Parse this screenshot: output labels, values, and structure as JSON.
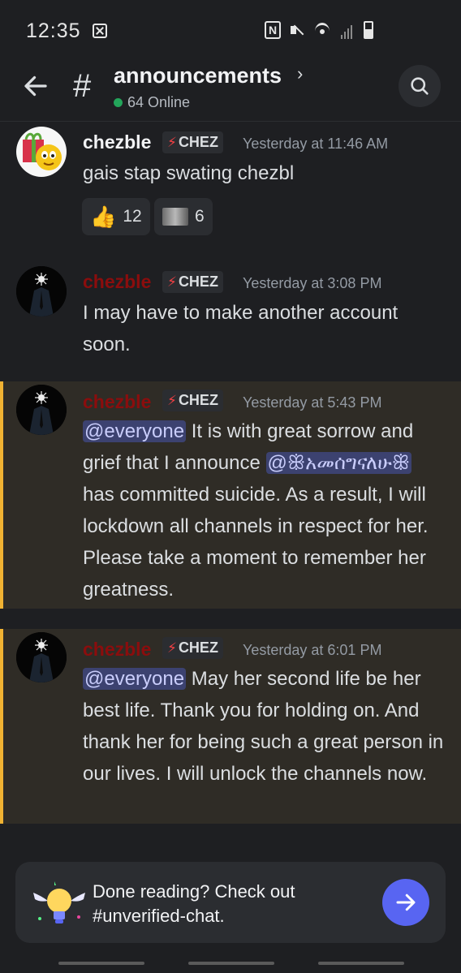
{
  "status_bar": {
    "time": "12:35"
  },
  "header": {
    "channel_name": "announcements",
    "chevron": "›",
    "online": "64 Online"
  },
  "messages": [
    {
      "author": "chezble",
      "author_color": "#f2f3f5",
      "tag": "CHEZ",
      "timestamp": "Yesterday at 11:46 AM",
      "content": "gais stap swating chezbl",
      "reactions": [
        {
          "emoji": "thumbs-up-icon",
          "count": "12"
        },
        {
          "emoji": "image-emoji-icon",
          "count": "6"
        }
      ]
    },
    {
      "author": "chezble",
      "author_color": "#8b0d0d",
      "tag": "CHEZ",
      "timestamp": "Yesterday at 3:08 PM",
      "content": "I may have to make another account soon."
    },
    {
      "author": "chezble",
      "author_color": "#8b0d0d",
      "tag": "CHEZ",
      "timestamp": "Yesterday at 5:43 PM",
      "mention": "@everyone",
      "content_a": " It is with great sorrow and grief that I announce ",
      "user_mention": "@ꕥአመሰግናለሁꕥ",
      "content_b": " has committed suicide. As a result, I will lockdown all channels in respect for her. Please take a moment to remember her greatness."
    },
    {
      "author": "chezble",
      "author_color": "#8b0d0d",
      "tag": "CHEZ",
      "timestamp": "Yesterday at 6:01 PM",
      "mention": "@everyone",
      "content": " May her second life be her best life. Thank you for holding on. And thank her for being such a great person in our lives. I will unlock the channels now."
    }
  ],
  "banner": {
    "text": "Done reading? Check out #unverified-chat."
  },
  "colors": {
    "background": "#1e1f22",
    "accent": "#5865f2",
    "mention_bar": "#f0b232",
    "online": "#23a55a"
  }
}
